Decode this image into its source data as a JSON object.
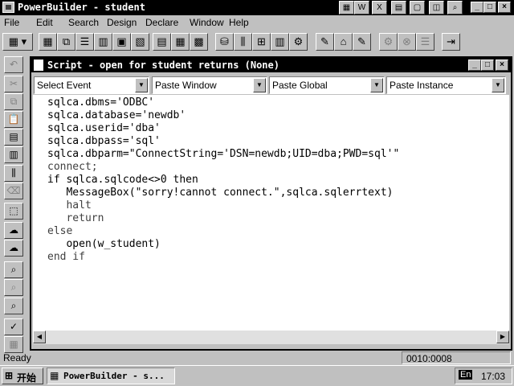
{
  "app": {
    "title": "PowerBuilder - student"
  },
  "title_icons": [
    "W",
    "X",
    "chart",
    "doc",
    "book",
    "check",
    "search"
  ],
  "menu": [
    "File",
    "Edit",
    "Search",
    "Design",
    "Declare",
    "Window",
    "Help"
  ],
  "script_window": {
    "title": "Script - open for student returns (None)",
    "dropdowns": [
      "Select Event",
      "Paste Window",
      "Paste Global",
      "Paste Instance"
    ],
    "code_lines": [
      "sqlca.dbms='ODBC'",
      "sqlca.database='newdb'",
      "sqlca.userid='dba'",
      "sqlca.dbpass='sql'",
      "sqlca.dbparm=\"ConnectString='DSN=newdb;UID=dba;PWD=sql'\"",
      "connect;",
      "if sqlca.sqlcode<>0 then",
      "   MessageBox(\"sorry!cannot connect.\",sqlca.sqlerrtext)",
      "   halt",
      "   return",
      "else",
      "   open(w_student)",
      "end if"
    ]
  },
  "status": {
    "text": "Ready",
    "position": "0010:0008"
  },
  "taskbar": {
    "start": "开始",
    "task": "PowerBuilder - s...",
    "lang": "En",
    "time": "17:03"
  },
  "colors": {
    "keyword": "#404040",
    "titlebar": "#000000",
    "face": "#c0c0c0"
  }
}
